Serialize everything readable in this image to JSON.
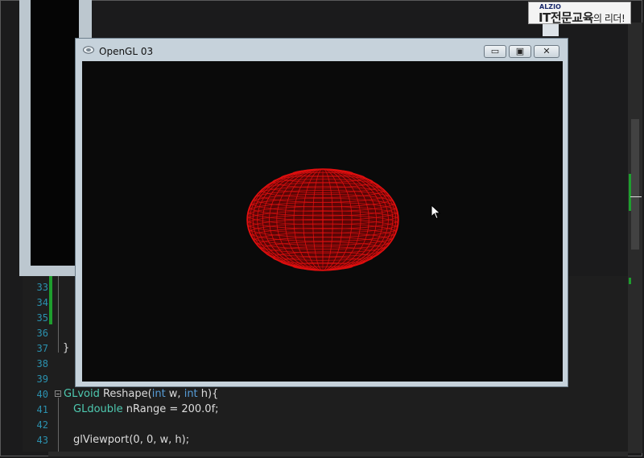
{
  "logo": {
    "small": "ALZIO",
    "main": "IT전문교육",
    "suffix": "의 리더!"
  },
  "gl_window": {
    "title": "OpenGL 03",
    "minimize_glyph": "▭",
    "maximize_glyph": "▣",
    "close_glyph": "✕"
  },
  "editor": {
    "line_numbers": [
      "33",
      "34",
      "35",
      "36",
      "37",
      "38",
      "39",
      "40",
      "41",
      "42",
      "43"
    ],
    "lines": {
      "l37": "}",
      "l40_type": "GLvoid",
      "l40_a": " Reshape(",
      "l40_kw1": "int",
      "l40_b": " w, ",
      "l40_kw2": "int",
      "l40_c": " h){",
      "l41_type": "GLdouble",
      "l41_rest": " nRange = 200.0f;",
      "l43": "glViewport(0, 0, w, h);"
    }
  },
  "colors": {
    "sphere": "#e01010",
    "change_marker": "#1e9e2e"
  }
}
